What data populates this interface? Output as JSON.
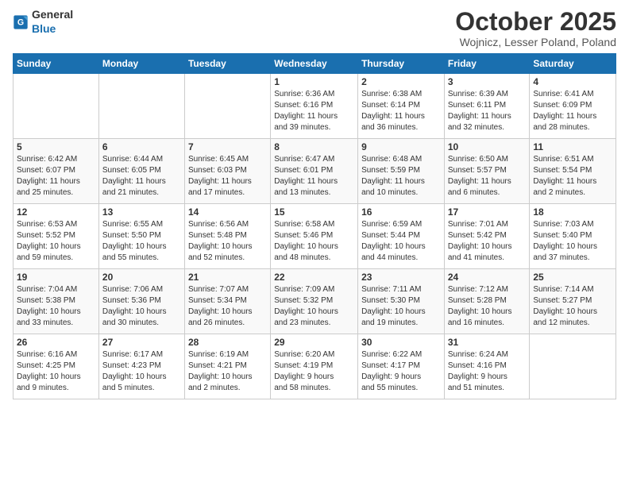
{
  "header": {
    "logo_general": "General",
    "logo_blue": "Blue",
    "month": "October 2025",
    "location": "Wojnicz, Lesser Poland, Poland"
  },
  "weekdays": [
    "Sunday",
    "Monday",
    "Tuesday",
    "Wednesday",
    "Thursday",
    "Friday",
    "Saturday"
  ],
  "weeks": [
    [
      {
        "day": "",
        "info": ""
      },
      {
        "day": "",
        "info": ""
      },
      {
        "day": "",
        "info": ""
      },
      {
        "day": "1",
        "info": "Sunrise: 6:36 AM\nSunset: 6:16 PM\nDaylight: 11 hours\nand 39 minutes."
      },
      {
        "day": "2",
        "info": "Sunrise: 6:38 AM\nSunset: 6:14 PM\nDaylight: 11 hours\nand 36 minutes."
      },
      {
        "day": "3",
        "info": "Sunrise: 6:39 AM\nSunset: 6:11 PM\nDaylight: 11 hours\nand 32 minutes."
      },
      {
        "day": "4",
        "info": "Sunrise: 6:41 AM\nSunset: 6:09 PM\nDaylight: 11 hours\nand 28 minutes."
      }
    ],
    [
      {
        "day": "5",
        "info": "Sunrise: 6:42 AM\nSunset: 6:07 PM\nDaylight: 11 hours\nand 25 minutes."
      },
      {
        "day": "6",
        "info": "Sunrise: 6:44 AM\nSunset: 6:05 PM\nDaylight: 11 hours\nand 21 minutes."
      },
      {
        "day": "7",
        "info": "Sunrise: 6:45 AM\nSunset: 6:03 PM\nDaylight: 11 hours\nand 17 minutes."
      },
      {
        "day": "8",
        "info": "Sunrise: 6:47 AM\nSunset: 6:01 PM\nDaylight: 11 hours\nand 13 minutes."
      },
      {
        "day": "9",
        "info": "Sunrise: 6:48 AM\nSunset: 5:59 PM\nDaylight: 11 hours\nand 10 minutes."
      },
      {
        "day": "10",
        "info": "Sunrise: 6:50 AM\nSunset: 5:57 PM\nDaylight: 11 hours\nand 6 minutes."
      },
      {
        "day": "11",
        "info": "Sunrise: 6:51 AM\nSunset: 5:54 PM\nDaylight: 11 hours\nand 2 minutes."
      }
    ],
    [
      {
        "day": "12",
        "info": "Sunrise: 6:53 AM\nSunset: 5:52 PM\nDaylight: 10 hours\nand 59 minutes."
      },
      {
        "day": "13",
        "info": "Sunrise: 6:55 AM\nSunset: 5:50 PM\nDaylight: 10 hours\nand 55 minutes."
      },
      {
        "day": "14",
        "info": "Sunrise: 6:56 AM\nSunset: 5:48 PM\nDaylight: 10 hours\nand 52 minutes."
      },
      {
        "day": "15",
        "info": "Sunrise: 6:58 AM\nSunset: 5:46 PM\nDaylight: 10 hours\nand 48 minutes."
      },
      {
        "day": "16",
        "info": "Sunrise: 6:59 AM\nSunset: 5:44 PM\nDaylight: 10 hours\nand 44 minutes."
      },
      {
        "day": "17",
        "info": "Sunrise: 7:01 AM\nSunset: 5:42 PM\nDaylight: 10 hours\nand 41 minutes."
      },
      {
        "day": "18",
        "info": "Sunrise: 7:03 AM\nSunset: 5:40 PM\nDaylight: 10 hours\nand 37 minutes."
      }
    ],
    [
      {
        "day": "19",
        "info": "Sunrise: 7:04 AM\nSunset: 5:38 PM\nDaylight: 10 hours\nand 33 minutes."
      },
      {
        "day": "20",
        "info": "Sunrise: 7:06 AM\nSunset: 5:36 PM\nDaylight: 10 hours\nand 30 minutes."
      },
      {
        "day": "21",
        "info": "Sunrise: 7:07 AM\nSunset: 5:34 PM\nDaylight: 10 hours\nand 26 minutes."
      },
      {
        "day": "22",
        "info": "Sunrise: 7:09 AM\nSunset: 5:32 PM\nDaylight: 10 hours\nand 23 minutes."
      },
      {
        "day": "23",
        "info": "Sunrise: 7:11 AM\nSunset: 5:30 PM\nDaylight: 10 hours\nand 19 minutes."
      },
      {
        "day": "24",
        "info": "Sunrise: 7:12 AM\nSunset: 5:28 PM\nDaylight: 10 hours\nand 16 minutes."
      },
      {
        "day": "25",
        "info": "Sunrise: 7:14 AM\nSunset: 5:27 PM\nDaylight: 10 hours\nand 12 minutes."
      }
    ],
    [
      {
        "day": "26",
        "info": "Sunrise: 6:16 AM\nSunset: 4:25 PM\nDaylight: 10 hours\nand 9 minutes."
      },
      {
        "day": "27",
        "info": "Sunrise: 6:17 AM\nSunset: 4:23 PM\nDaylight: 10 hours\nand 5 minutes."
      },
      {
        "day": "28",
        "info": "Sunrise: 6:19 AM\nSunset: 4:21 PM\nDaylight: 10 hours\nand 2 minutes."
      },
      {
        "day": "29",
        "info": "Sunrise: 6:20 AM\nSunset: 4:19 PM\nDaylight: 9 hours\nand 58 minutes."
      },
      {
        "day": "30",
        "info": "Sunrise: 6:22 AM\nSunset: 4:17 PM\nDaylight: 9 hours\nand 55 minutes."
      },
      {
        "day": "31",
        "info": "Sunrise: 6:24 AM\nSunset: 4:16 PM\nDaylight: 9 hours\nand 51 minutes."
      },
      {
        "day": "",
        "info": ""
      }
    ]
  ]
}
